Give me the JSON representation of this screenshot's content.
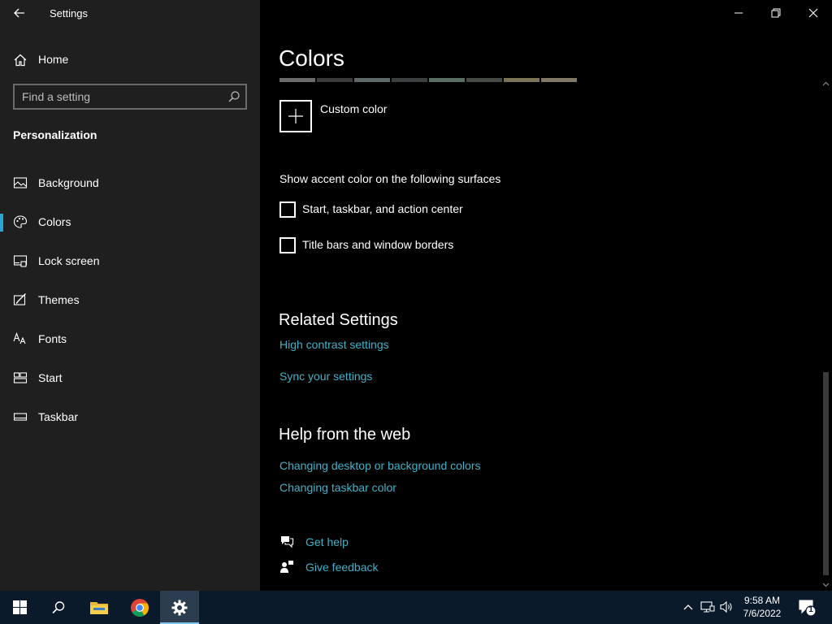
{
  "window": {
    "title": "Settings"
  },
  "sidebar": {
    "home_label": "Home",
    "search_placeholder": "Find a setting",
    "section_title": "Personalization",
    "items": [
      {
        "label": "Background",
        "icon": "picture-icon",
        "selected": false
      },
      {
        "label": "Colors",
        "icon": "palette-icon",
        "selected": true
      },
      {
        "label": "Lock screen",
        "icon": "lock-screen-icon",
        "selected": false
      },
      {
        "label": "Themes",
        "icon": "themes-icon",
        "selected": false
      },
      {
        "label": "Fonts",
        "icon": "fonts-icon",
        "selected": false
      },
      {
        "label": "Start",
        "icon": "start-icon",
        "selected": false
      },
      {
        "label": "Taskbar",
        "icon": "taskbar-icon",
        "selected": false
      }
    ]
  },
  "main": {
    "title": "Colors",
    "swatch_colors": [
      "#6b6b6b",
      "#3b3b3b",
      "#5d6868",
      "#3c4040",
      "#5b6e63",
      "#454a45",
      "#7b7358",
      "#827866"
    ],
    "custom_color_label": "Custom color",
    "surfaces_heading": "Show accent color on the following surfaces",
    "checkboxes": [
      {
        "label": "Start, taskbar, and action center",
        "checked": false
      },
      {
        "label": "Title bars and window borders",
        "checked": false
      }
    ],
    "related_heading": "Related Settings",
    "related_links": [
      "High contrast settings",
      "Sync your settings"
    ],
    "help_heading": "Help from the web",
    "help_links": [
      "Changing desktop or background colors",
      "Changing taskbar color"
    ],
    "get_help": "Get help",
    "give_feedback": "Give feedback"
  },
  "taskbar": {
    "time": "9:58 AM",
    "date": "7/6/2022",
    "notification_count": "1"
  },
  "colors": {
    "accent_link": "#3fb2c9",
    "selection_bar": "#2aa3d8",
    "sidebar_bg": "#1f1f1f",
    "taskbar_bg": "#0a1a2a"
  }
}
